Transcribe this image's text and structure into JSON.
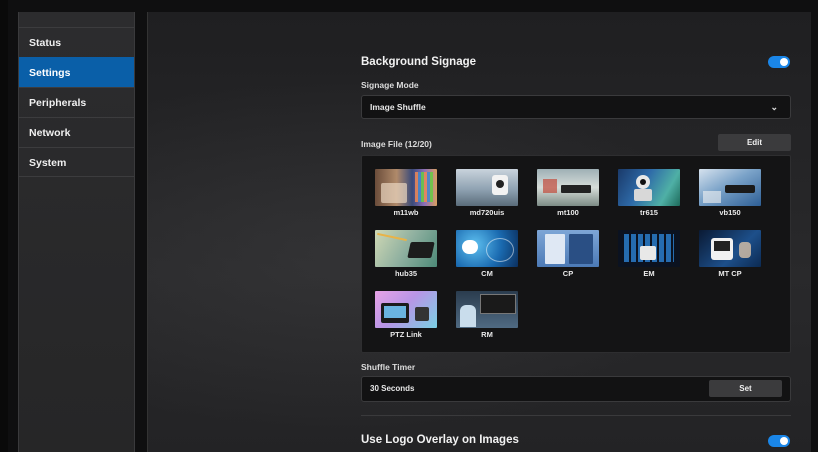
{
  "sidebar": {
    "items": [
      {
        "label": "Status",
        "active": false
      },
      {
        "label": "Settings",
        "active": true
      },
      {
        "label": "Peripherals",
        "active": false
      },
      {
        "label": "Network",
        "active": false
      },
      {
        "label": "System",
        "active": false
      }
    ]
  },
  "background_signage": {
    "title": "Background Signage",
    "enabled": true,
    "signage_mode_label": "Signage Mode",
    "signage_mode_value": "Image Shuffle",
    "image_file_label": "Image File (12/20)",
    "edit_label": "Edit",
    "images": [
      "m11wb",
      "md720uis",
      "mt100",
      "tr615",
      "vb150",
      "hub35",
      "CM",
      "CP",
      "EM",
      "MT CP",
      "PTZ Link",
      "RM"
    ]
  },
  "shuffle_timer": {
    "label": "Shuffle Timer",
    "value": "30 Seconds",
    "set_label": "Set"
  },
  "logo_overlay": {
    "title": "Use Logo Overlay on Images",
    "enabled": true
  },
  "colors": {
    "accent": "#1a86e8",
    "active_nav": "#0a5fa8"
  }
}
